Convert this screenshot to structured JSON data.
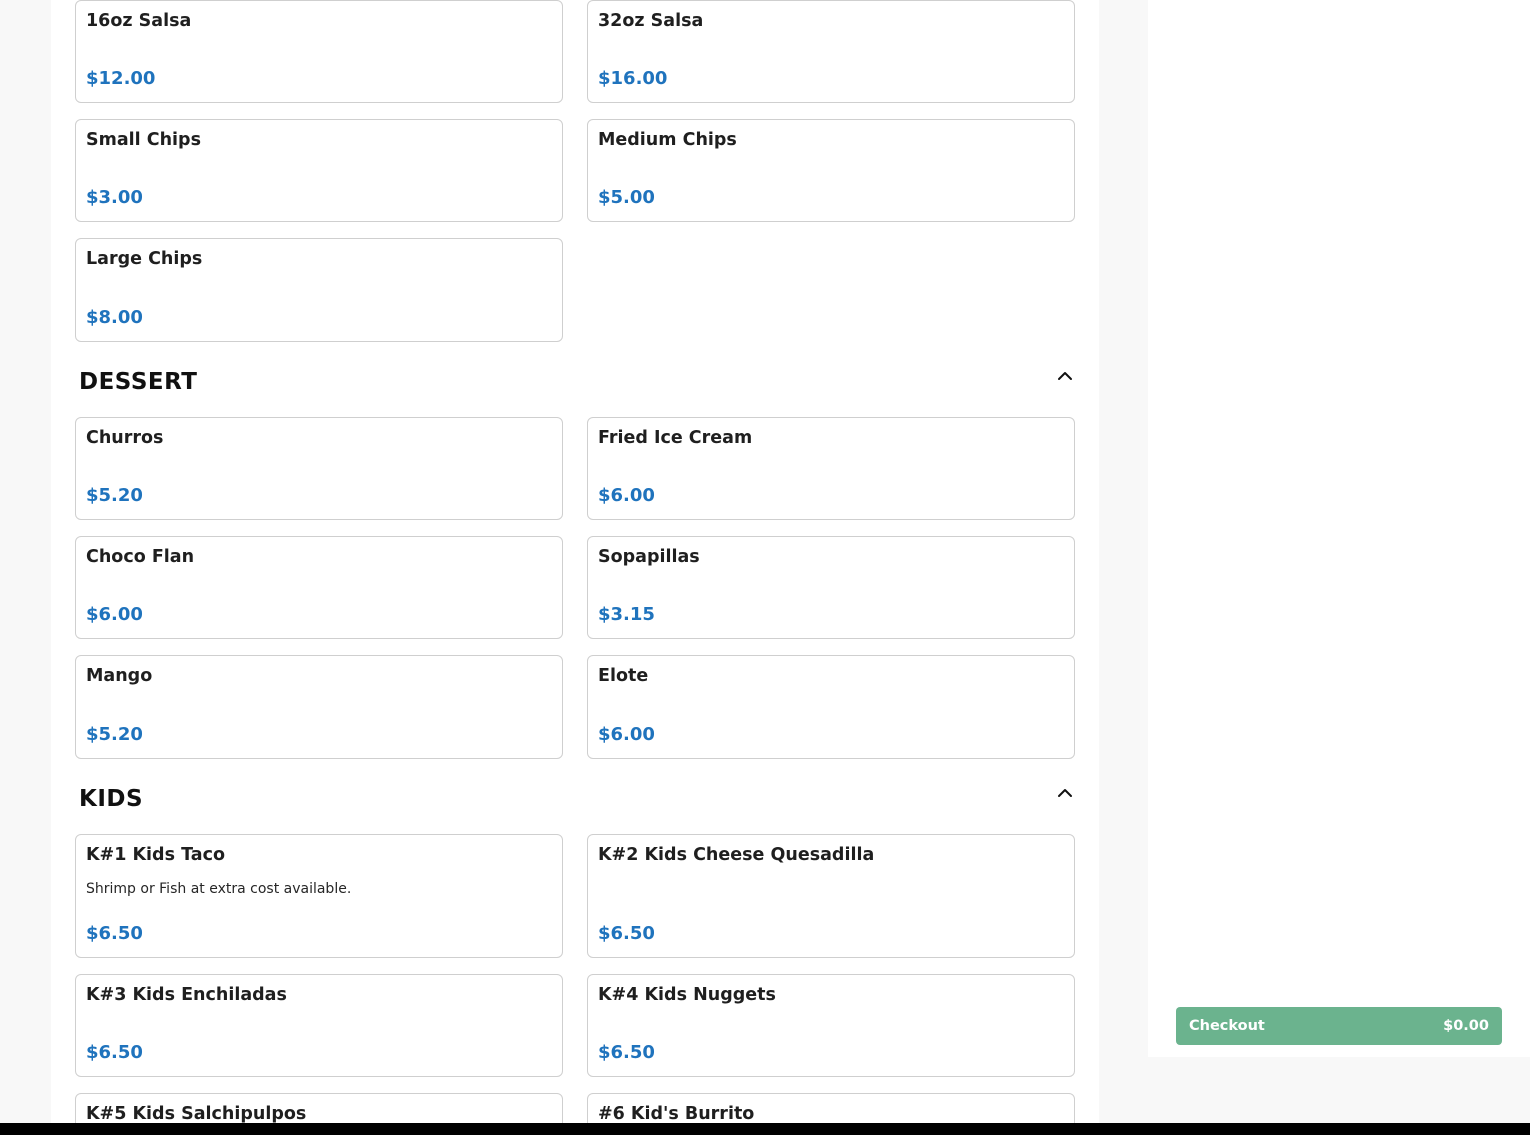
{
  "sections": {
    "sides": {
      "items": [
        {
          "name": "16oz Salsa",
          "price": "$12.00"
        },
        {
          "name": "32oz Salsa",
          "price": "$16.00"
        },
        {
          "name": "Small Chips",
          "price": "$3.00"
        },
        {
          "name": "Medium Chips",
          "price": "$5.00"
        },
        {
          "name": "Large Chips",
          "price": "$8.00"
        }
      ]
    },
    "dessert": {
      "title": "DESSERT",
      "items": [
        {
          "name": "Churros",
          "price": "$5.20"
        },
        {
          "name": "Fried Ice Cream",
          "price": "$6.00"
        },
        {
          "name": "Choco Flan",
          "price": "$6.00"
        },
        {
          "name": "Sopapillas",
          "price": "$3.15"
        },
        {
          "name": "Mango",
          "price": "$5.20"
        },
        {
          "name": "Elote",
          "price": "$6.00"
        }
      ]
    },
    "kids": {
      "title": "KIDS",
      "items": [
        {
          "name": "K#1 Kids Taco",
          "description": "Shrimp or Fish at extra cost available.",
          "price": "$6.50"
        },
        {
          "name": "K#2 Kids Cheese Quesadilla",
          "price": "$6.50"
        },
        {
          "name": "K#3 Kids Enchiladas",
          "price": "$6.50"
        },
        {
          "name": "K#4 Kids Nuggets",
          "price": "$6.50"
        },
        {
          "name": "K#5 Kids Salchipulpos"
        },
        {
          "name": "#6 Kid's Burrito"
        }
      ]
    }
  },
  "cart": {
    "checkout_label": "Checkout",
    "total": "$0.00"
  },
  "icons": {
    "section_toggle": "chevron-up-icon"
  },
  "colors": {
    "price": "#1f73bd",
    "checkout_button": "#6bb38e"
  }
}
